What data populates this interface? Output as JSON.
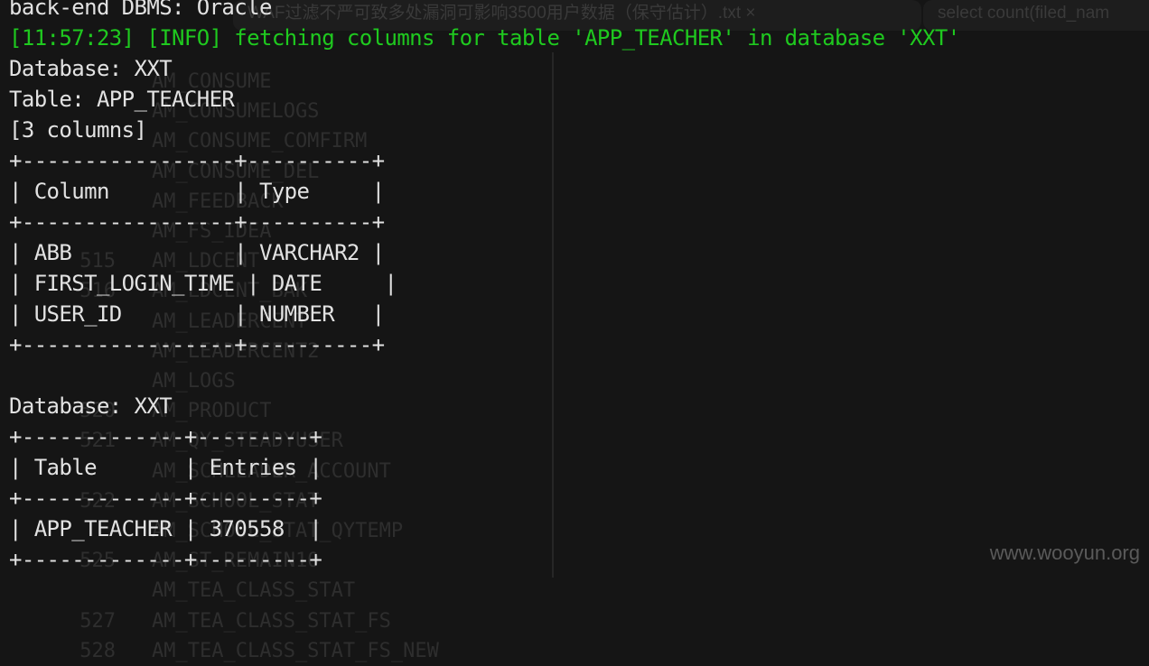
{
  "background_window": {
    "tab1": "WAF过滤不严可致多处漏洞可影响3500用户数据（保守估计）.txt  ×",
    "tab2": "select count(filed_nam",
    "rows": [
      {
        "num": "",
        "name": "AM_CONSUME"
      },
      {
        "num": "",
        "name": "AM_CONSUMELOGS"
      },
      {
        "num": "",
        "name": "AM_CONSUME_COMFIRM"
      },
      {
        "num": "",
        "name": "AM_CONSUME_DEL"
      },
      {
        "num": "",
        "name": "AM_FEEDBACK"
      },
      {
        "num": "",
        "name": "AM_FS_IDEA"
      },
      {
        "num": "515",
        "name": "AM_LDCENT"
      },
      {
        "num": "516",
        "name": "AM_LDCENT_BAK"
      },
      {
        "num": "",
        "name": "AM_LEADERCENT"
      },
      {
        "num": "",
        "name": "AM_LEADERCENT2"
      },
      {
        "num": "",
        "name": "AM_LOGS"
      },
      {
        "num": "520",
        "name": "AM_PRODUCT"
      },
      {
        "num": "521",
        "name": "AM_QY_STEADYUSER"
      },
      {
        "num": "",
        "name": "AM_SCHLEADER_ACCOUNT"
      },
      {
        "num": "522",
        "name": "AM_SCHOOL_STAT"
      },
      {
        "num": "",
        "name": "AM_SCHOOL_STAT_QYTEMP"
      },
      {
        "num": "525",
        "name": "AM_ST_REMAIN10"
      },
      {
        "num": "",
        "name": "AM_TEA_CLASS_STAT"
      },
      {
        "num": "527",
        "name": "AM_TEA_CLASS_STAT_FS"
      },
      {
        "num": "528",
        "name": "AM_TEA_CLASS_STAT_FS_NEW"
      }
    ]
  },
  "terminal": {
    "lines": [
      {
        "text": "back-end DBMS: Oracle",
        "kind": "plain"
      },
      {
        "text": "[11:57:23] [INFO] fetching columns for table 'APP_TEACHER' in database 'XXT'",
        "kind": "info"
      },
      {
        "text": "Database: XXT",
        "kind": "plain"
      },
      {
        "text": "Table: APP_TEACHER",
        "kind": "plain"
      },
      {
        "text": "[3 columns]",
        "kind": "plain"
      },
      {
        "text": "+-----------------+----------+",
        "kind": "border"
      },
      {
        "text": "| Column          | Type     |",
        "kind": "header"
      },
      {
        "text": "+-----------------+----------+",
        "kind": "border"
      },
      {
        "text": "| ABB             | VARCHAR2 |",
        "kind": "row"
      },
      {
        "text": "| FIRST_LOGIN_TIME | DATE     |",
        "kind": "row"
      },
      {
        "text": "| USER_ID         | NUMBER   |",
        "kind": "row"
      },
      {
        "text": "+-----------------+----------+",
        "kind": "border"
      },
      {
        "text": "",
        "kind": "blank"
      },
      {
        "text": "Database: XXT",
        "kind": "plain"
      },
      {
        "text": "+-------------+---------+",
        "kind": "border"
      },
      {
        "text": "| Table       | Entries |",
        "kind": "header"
      },
      {
        "text": "+-------------+---------+",
        "kind": "border"
      },
      {
        "text": "| APP_TEACHER | 370558  |",
        "kind": "row"
      },
      {
        "text": "+-------------+---------+",
        "kind": "border"
      }
    ]
  },
  "watermark": "www.wooyun.org",
  "colors": {
    "info": "#1fc91f",
    "text": "#e2e2e2",
    "background": "#151515"
  }
}
